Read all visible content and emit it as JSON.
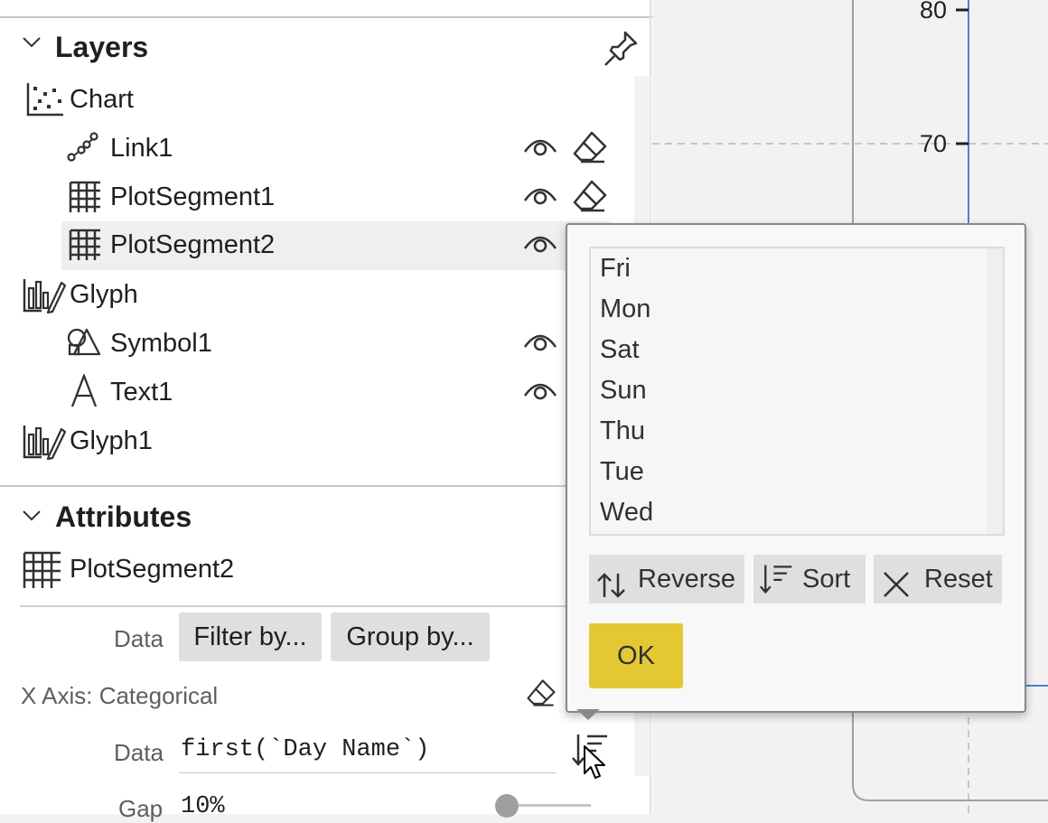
{
  "layers": {
    "title": "Layers",
    "items": [
      {
        "label": "Chart",
        "icon": "scatter-chart-icon"
      },
      {
        "label": "Link1",
        "icon": "link-icon"
      },
      {
        "label": "PlotSegment1",
        "icon": "grid-icon"
      },
      {
        "label": "PlotSegment2",
        "icon": "grid-icon",
        "selected": true
      },
      {
        "label": "Glyph",
        "icon": "glyph-icon"
      },
      {
        "label": "Symbol1",
        "icon": "shapes-icon"
      },
      {
        "label": "Text1",
        "icon": "text-icon"
      },
      {
        "label": "Glyph1",
        "icon": "glyph-icon"
      }
    ]
  },
  "attributes": {
    "title": "Attributes",
    "object_name": "PlotSegment2",
    "data_label": "Data",
    "filter_button": "Filter by...",
    "group_button": "Group by...",
    "x_axis_label": "X Axis: Categorical",
    "x_data_label": "Data",
    "x_data_value": "first(`Day Name`)",
    "gap_label": "Gap",
    "gap_value": "10%"
  },
  "canvas": {
    "y_ticks": [
      "80",
      "70"
    ]
  },
  "order_popup": {
    "items": [
      "Fri",
      "Mon",
      "Sat",
      "Sun",
      "Thu",
      "Tue",
      "Wed"
    ],
    "reverse_label": "Reverse",
    "sort_label": "Sort",
    "reset_label": "Reset",
    "ok_label": "OK"
  },
  "colors": {
    "accent_ok": "#e3c833",
    "canvas_axis_blue": "#4a7fdc"
  }
}
